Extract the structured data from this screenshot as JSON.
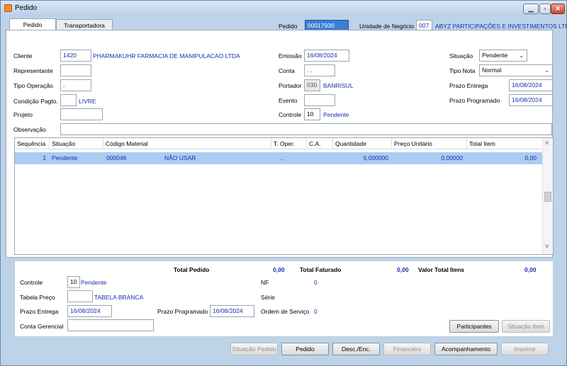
{
  "window": {
    "title": "Pedido"
  },
  "header": {
    "pedido_label": "Pedido",
    "pedido_value": "00017930",
    "unidade_label": "Unidade de Negócio",
    "unidade_code": "007",
    "unidade_name": "ABYZ PARTICIPAÇÕES E INVESTIMENTOS LTI"
  },
  "tabs": [
    "Pedido",
    "Transportadora"
  ],
  "form": {
    "cliente_label": "Cliente",
    "cliente_code": "1420",
    "cliente_name": "PHARMAKUHR FARMACIA DE MANIPULACAO LTDA",
    "representante_label": "Representante",
    "tipo_operacao_label": "Tipo Operação",
    "tipo_operacao_value": ".",
    "condicao_label": "Condição Pagto.",
    "condicao_name": "LIVRE",
    "projeto_label": "Projeto",
    "observacao_label": "Observação",
    "emissao_label": "Emissão",
    "emissao_value": "16/08/2024",
    "conta_label": "Conta",
    "conta_value": ". .",
    "portador_label": "Portador",
    "portador_code": "030",
    "portador_name": "BANRISUL",
    "evento_label": "Evento",
    "controle_label": "Controle",
    "controle_value": "10",
    "controle_status": "Pendente",
    "situacao_label": "Situação",
    "situacao_value": "Pendente",
    "tipo_nota_label": "Tipo Nota",
    "tipo_nota_value": "Normal",
    "prazo_entrega_label": "Prazo Entrega",
    "prazo_entrega_value": "16/08/2024",
    "prazo_programado_label": "Prazo Programado",
    "prazo_programado_value": "16/08/2024"
  },
  "grid": {
    "columns": [
      "Sequência",
      "Situação",
      "Código Material",
      "T. Oper.",
      "C.A.",
      "Quantidade",
      "Preço Unitário",
      "Total Item"
    ],
    "rows": [
      {
        "seq": "1",
        "situacao": "Pendente",
        "codigo": "000046",
        "descricao": "NÃO USAR",
        "toper": ".",
        "ca": "",
        "quantidade": "0,000000",
        "preco": "0,00000",
        "total": "0,00"
      }
    ]
  },
  "summary": {
    "total_pedido_label": "Total Pedido",
    "total_pedido_value": "0,00",
    "total_faturado_label": "Total Faturado",
    "total_faturado_value": "0,00",
    "valor_total_itens_label": "Valor Total Itens",
    "valor_total_itens_value": "0,00",
    "controle_label": "Controle",
    "controle_value": "10",
    "controle_status": "Pendente",
    "nf_label": "NF",
    "nf_value": "0",
    "tabela_preco_label": "Tabela Preço",
    "tabela_preco_name": "TABELA BRANCA",
    "serie_label": "Série",
    "prazo_entrega_label": "Prazo Entrega",
    "prazo_entrega_value": "16/08/2024",
    "prazo_programado_label": "Prazo Programado",
    "prazo_programado_value": "16/08/2024",
    "ordem_servico_label": "Ordem de Serviço",
    "ordem_servico_value": "0",
    "conta_gerencial_label": "Conta Gerencial"
  },
  "buttons": {
    "participantes": "Participantes",
    "situacao_item": "Situação Item",
    "situacao_pedido": "Situação Pedido",
    "pedido": "Pedido",
    "desc_enc": "Desc./Enc.",
    "financeiro": "Financeiro",
    "acompanhamento": "Acompanhamento",
    "imprimir": "Imprimir"
  },
  "colors": {
    "accent_text": "#1a2bb0",
    "selection": "#a9cdf2"
  }
}
